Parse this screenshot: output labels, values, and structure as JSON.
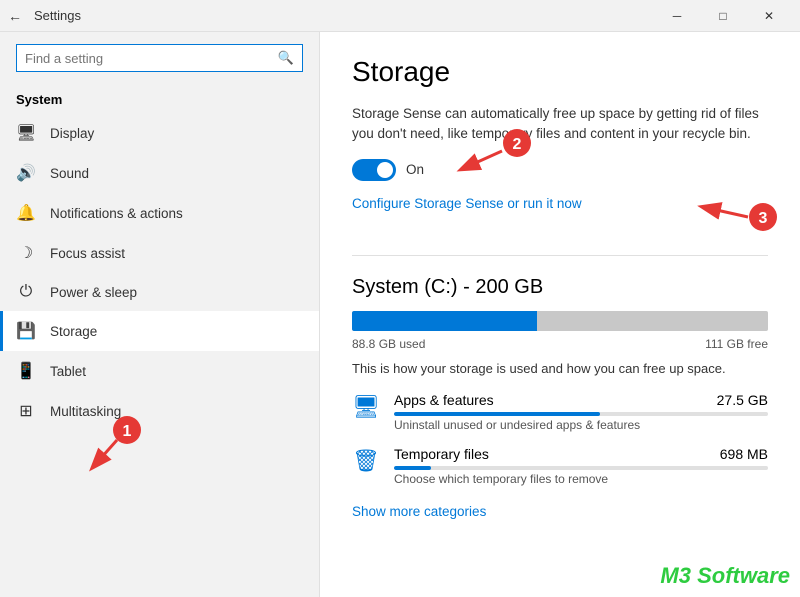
{
  "titlebar": {
    "back_icon": "←",
    "title": "Settings",
    "minimize": "─",
    "maximize": "□",
    "close": "✕"
  },
  "sidebar": {
    "search_placeholder": "Find a setting",
    "search_icon": "🔍",
    "section_title": "System",
    "items": [
      {
        "id": "display",
        "label": "Display",
        "icon": "🖥"
      },
      {
        "id": "sound",
        "label": "Sound",
        "icon": "🔊"
      },
      {
        "id": "notifications",
        "label": "Notifications & actions",
        "icon": "🔔"
      },
      {
        "id": "focus",
        "label": "Focus assist",
        "icon": "🌙"
      },
      {
        "id": "power",
        "label": "Power & sleep",
        "icon": "⏻"
      },
      {
        "id": "storage",
        "label": "Storage",
        "icon": "💾",
        "active": true
      },
      {
        "id": "tablet",
        "label": "Tablet",
        "icon": "📱"
      },
      {
        "id": "multitasking",
        "label": "Multitasking",
        "icon": "⬛"
      }
    ]
  },
  "content": {
    "title": "Storage",
    "description": "Storage Sense can automatically free up space by getting rid of files you don't need, like temporary files and content in your recycle bin.",
    "toggle_state": "on",
    "toggle_label": "On",
    "configure_link": "Configure Storage Sense or run it now",
    "system_drive": {
      "title": "System (C:) - 200 GB",
      "used_label": "88.8 GB used",
      "free_label": "111 GB free",
      "used_percent": 44.4,
      "description": "This is how your storage is used and how you can free up space."
    },
    "storage_items": [
      {
        "id": "apps",
        "icon": "🖥",
        "label": "Apps & features",
        "size": "27.5 GB",
        "sub": "Uninstall unused or undesired apps & features",
        "bar_percent": 55
      },
      {
        "id": "temp",
        "icon": "🗑",
        "label": "Temporary files",
        "size": "698 MB",
        "sub": "Choose which temporary files to remove",
        "bar_percent": 10
      }
    ],
    "show_more": "Show more categories"
  },
  "watermark": {
    "text": "M3 Software"
  },
  "annotations": {
    "circle1": "1",
    "circle2": "2",
    "circle3": "3"
  }
}
